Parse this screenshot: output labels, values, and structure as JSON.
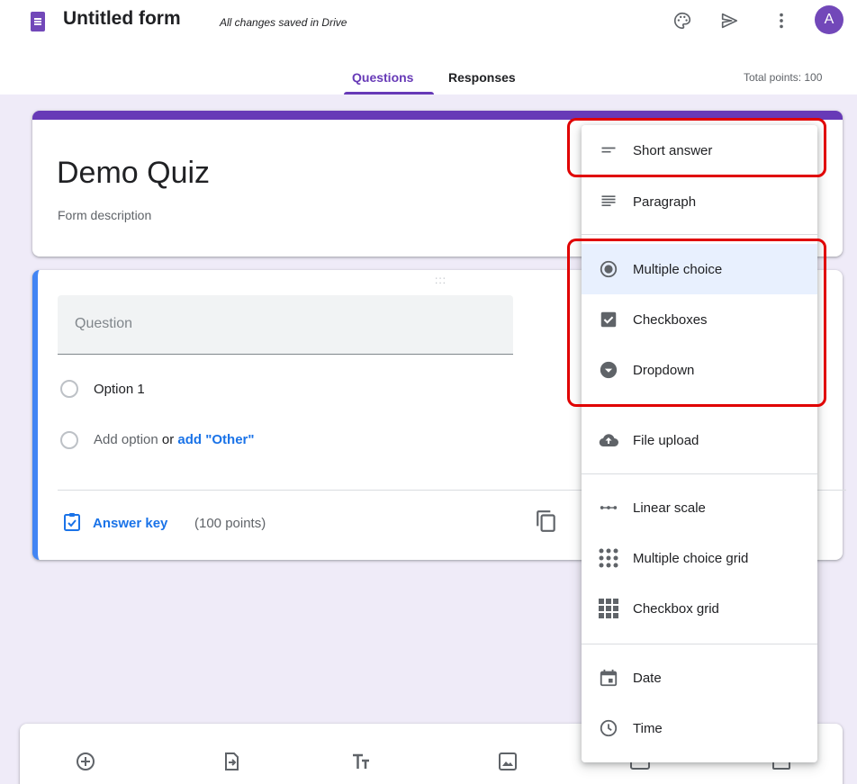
{
  "header": {
    "title": "Untitled form",
    "save_status": "All changes saved in Drive",
    "avatar_letter": "A",
    "icons": [
      "palette-icon",
      "send-icon",
      "more-vert-icon"
    ]
  },
  "tabs": [
    {
      "label": "Questions",
      "active": true
    },
    {
      "label": "Responses",
      "active": false
    }
  ],
  "total_points": "Total points: 100",
  "form": {
    "title": "Demo Quiz",
    "description": "Form description"
  },
  "question": {
    "placeholder": "Question",
    "options": [
      "Option 1"
    ],
    "add_option": "Add option",
    "or": "or",
    "add_other": "add \"Other\"",
    "answer_key": "Answer key",
    "points": "(100 points)"
  },
  "question_type_menu": {
    "items": [
      {
        "label": "Short answer",
        "icon": "short-answer-icon"
      },
      {
        "label": "Paragraph",
        "icon": "paragraph-icon"
      },
      {
        "label": "Multiple choice",
        "icon": "radio-button-icon",
        "selected": true
      },
      {
        "label": "Checkboxes",
        "icon": "checkbox-icon"
      },
      {
        "label": "Dropdown",
        "icon": "dropdown-icon"
      },
      {
        "label": "File upload",
        "icon": "cloud-upload-icon"
      },
      {
        "label": "Linear scale",
        "icon": "linear-scale-icon"
      },
      {
        "label": "Multiple choice grid",
        "icon": "grid-dots-icon"
      },
      {
        "label": "Checkbox grid",
        "icon": "grid-squares-icon"
      },
      {
        "label": "Date",
        "icon": "calendar-icon"
      },
      {
        "label": "Time",
        "icon": "clock-icon"
      }
    ]
  },
  "bottom_toolbar": [
    "add-question-icon",
    "import-questions-icon",
    "add-title-icon",
    "add-image-icon",
    "add-video-icon",
    "add-section-icon"
  ],
  "colors": {
    "accent": "#673ab7",
    "active_card": "#4285f4",
    "link": "#1a73e8",
    "background": "#efebf8",
    "highlight": "#e00000"
  }
}
